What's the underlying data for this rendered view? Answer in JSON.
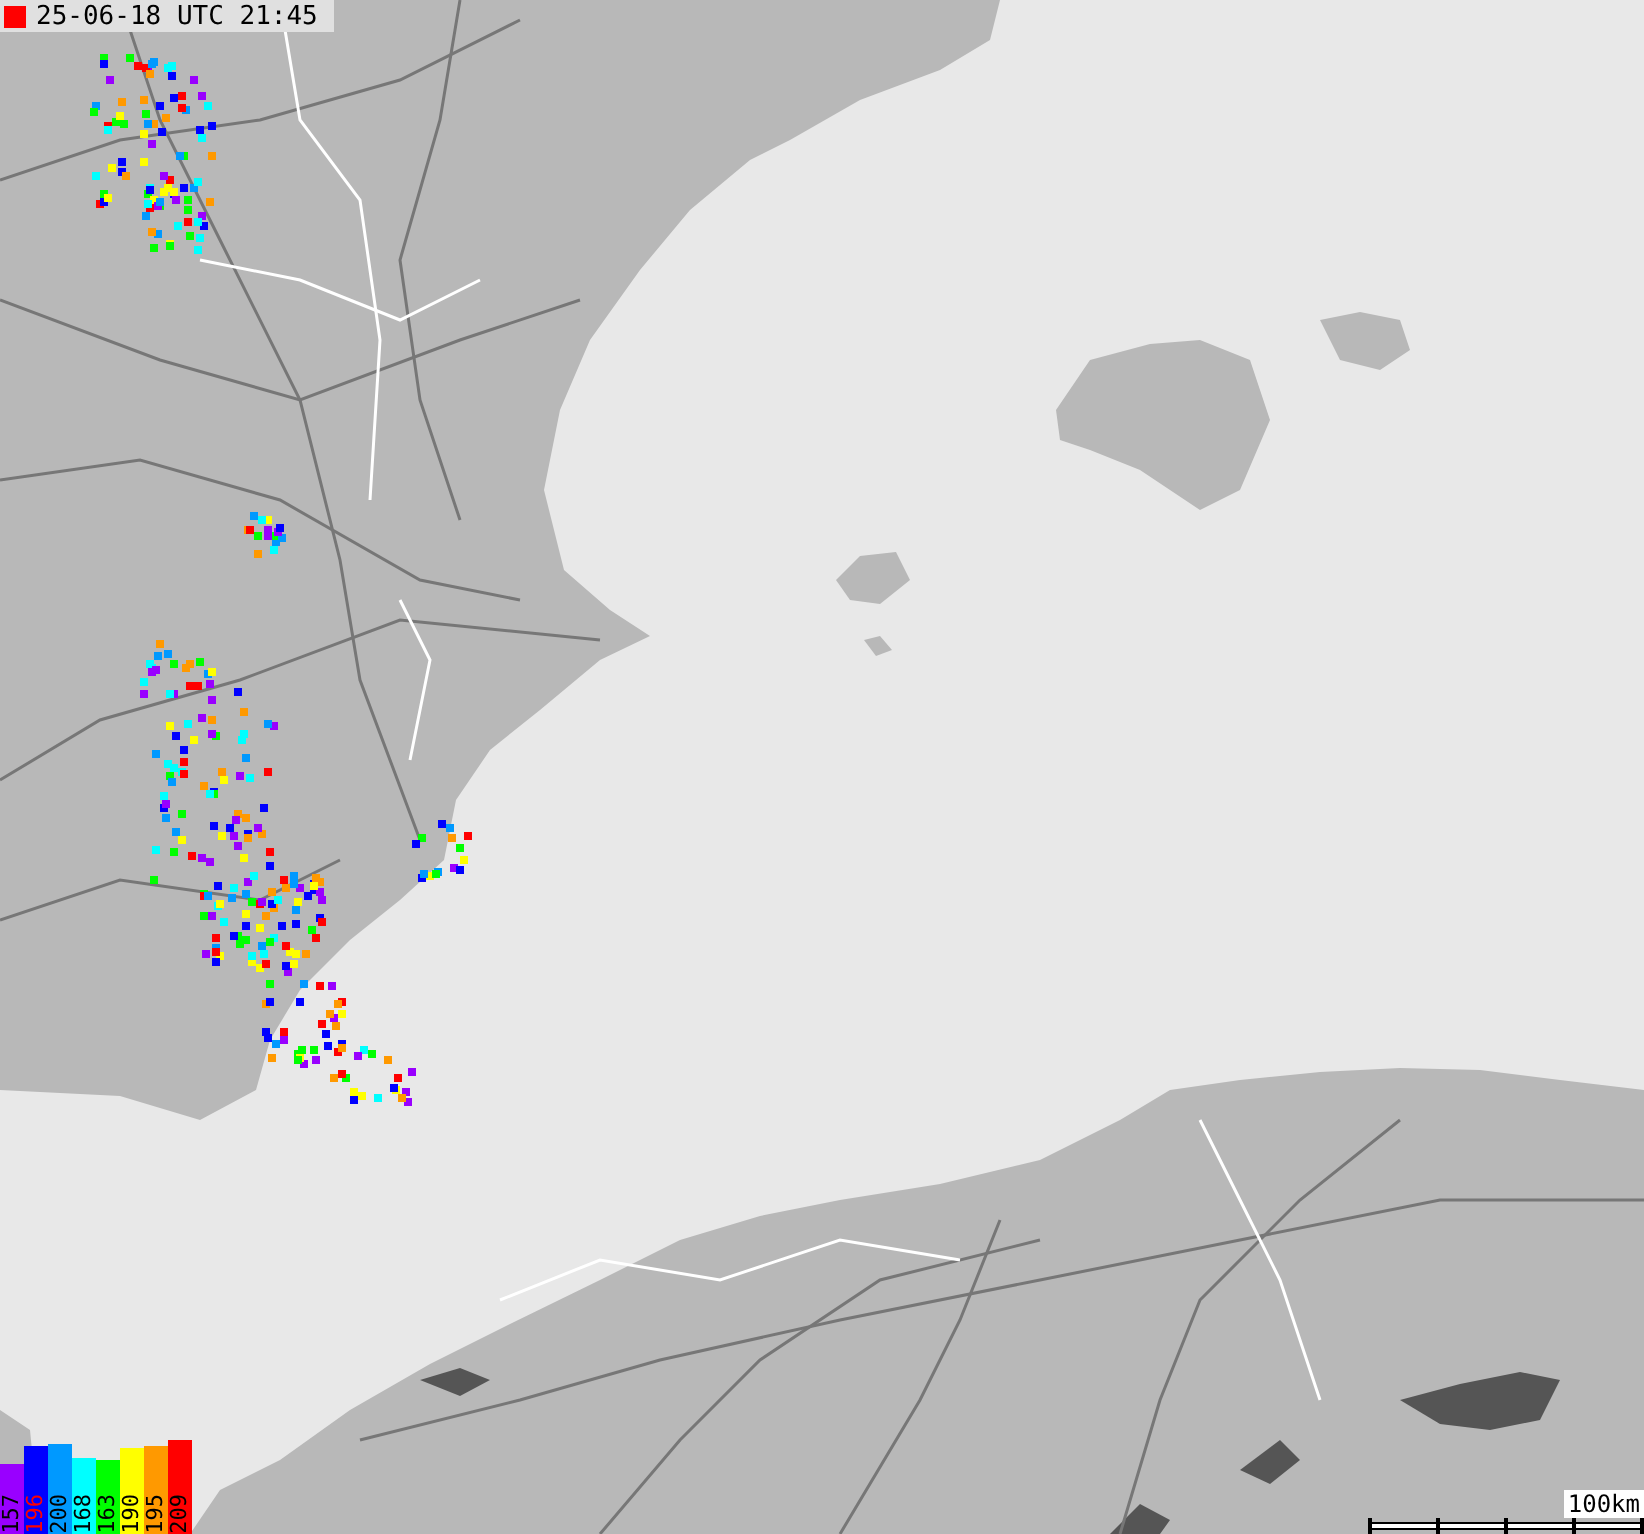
{
  "timestamp": {
    "text": "25-06-18 UTC 21:45"
  },
  "legend": [
    {
      "label": "157",
      "color": "#9900ff"
    },
    {
      "label": "196",
      "color": "#0000ff"
    },
    {
      "label": "200",
      "color": "#0099ff"
    },
    {
      "label": "168",
      "color": "#00ffff"
    },
    {
      "label": "163",
      "color": "#00ff00"
    },
    {
      "label": "190",
      "color": "#ffff00"
    },
    {
      "label": "195",
      "color": "#ff9900"
    },
    {
      "label": "209",
      "color": "#ff0000"
    }
  ],
  "scale": {
    "label": "100km"
  }
}
